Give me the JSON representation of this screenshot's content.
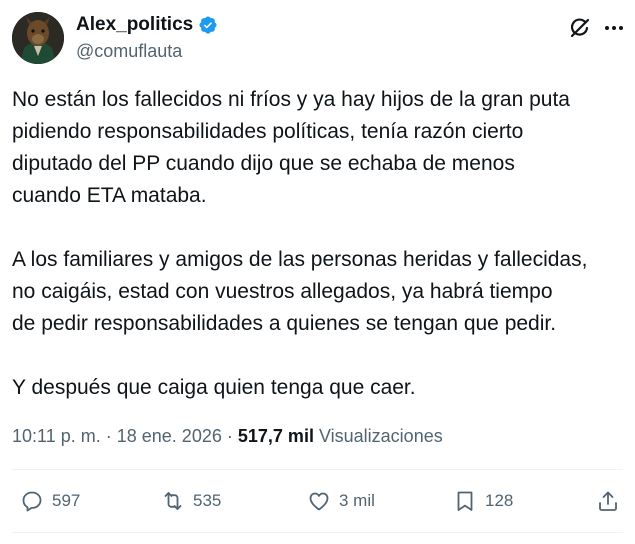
{
  "author": {
    "name": "Alex_politics",
    "handle": "@comuflauta"
  },
  "tweet": {
    "paragraphs": [
      [
        "No están los fallecidos ni fríos y ya hay hijos de la gran puta",
        "pidiendo responsabilidades políticas, tenía razón cierto",
        "diputado del PP cuando dijo que se echaba de menos",
        "cuando ETA mataba."
      ],
      [
        "A los familiares y amigos de las personas heridas y fallecidas,",
        "no caigáis,  estad con vuestros allegados, ya habrá tiempo",
        "de pedir responsabilidades a quienes se tengan que pedir."
      ],
      [
        "Y después que caiga quien tenga que caer."
      ]
    ]
  },
  "meta": {
    "time": "10:11 p. m.",
    "separator": "·",
    "date": "18 ene. 2026",
    "views_count": "517,7 mil",
    "views_label": "Visualizaciones"
  },
  "actions": {
    "replies": "597",
    "reposts": "535",
    "likes": "3 mil",
    "bookmarks": "128"
  },
  "icons": [
    "verified-badge-icon",
    "grok-icon",
    "more-icon",
    "reply-icon",
    "repost-icon",
    "like-icon",
    "bookmark-icon",
    "share-icon"
  ],
  "colors": {
    "text": "#0f1419",
    "secondary": "#536471",
    "verified": "#1d9bf0",
    "divider": "#eff3f4"
  }
}
